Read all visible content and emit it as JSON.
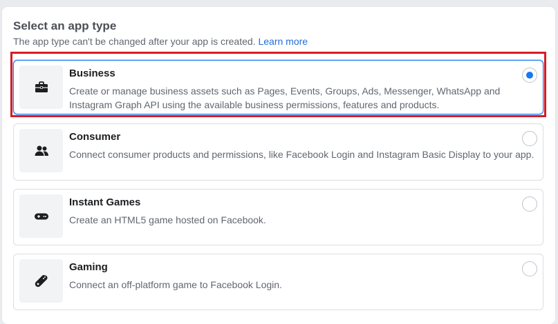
{
  "header": {
    "title": "Select an app type",
    "subtitle": "The app type can't be changed after your app is created.",
    "learn_more": "Learn more"
  },
  "app_types": [
    {
      "title": "Business",
      "description": "Create or manage business assets such as Pages, Events, Groups, Ads, Messenger, WhatsApp and Instagram Graph API using the available business permissions, features and products.",
      "icon": "briefcase-icon",
      "selected": true
    },
    {
      "title": "Consumer",
      "description": "Connect consumer products and permissions, like Facebook Login and Instagram Basic Display to your app.",
      "icon": "people-icon",
      "selected": false
    },
    {
      "title": "Instant Games",
      "description": "Create an HTML5 game hosted on Facebook.",
      "icon": "game-controller-icon",
      "selected": false
    },
    {
      "title": "Gaming",
      "description": "Connect an off-platform game to Facebook Login.",
      "icon": "gamepad-icon",
      "selected": false
    }
  ],
  "colors": {
    "accent": "#1877f2",
    "highlight": "#d81b25"
  }
}
